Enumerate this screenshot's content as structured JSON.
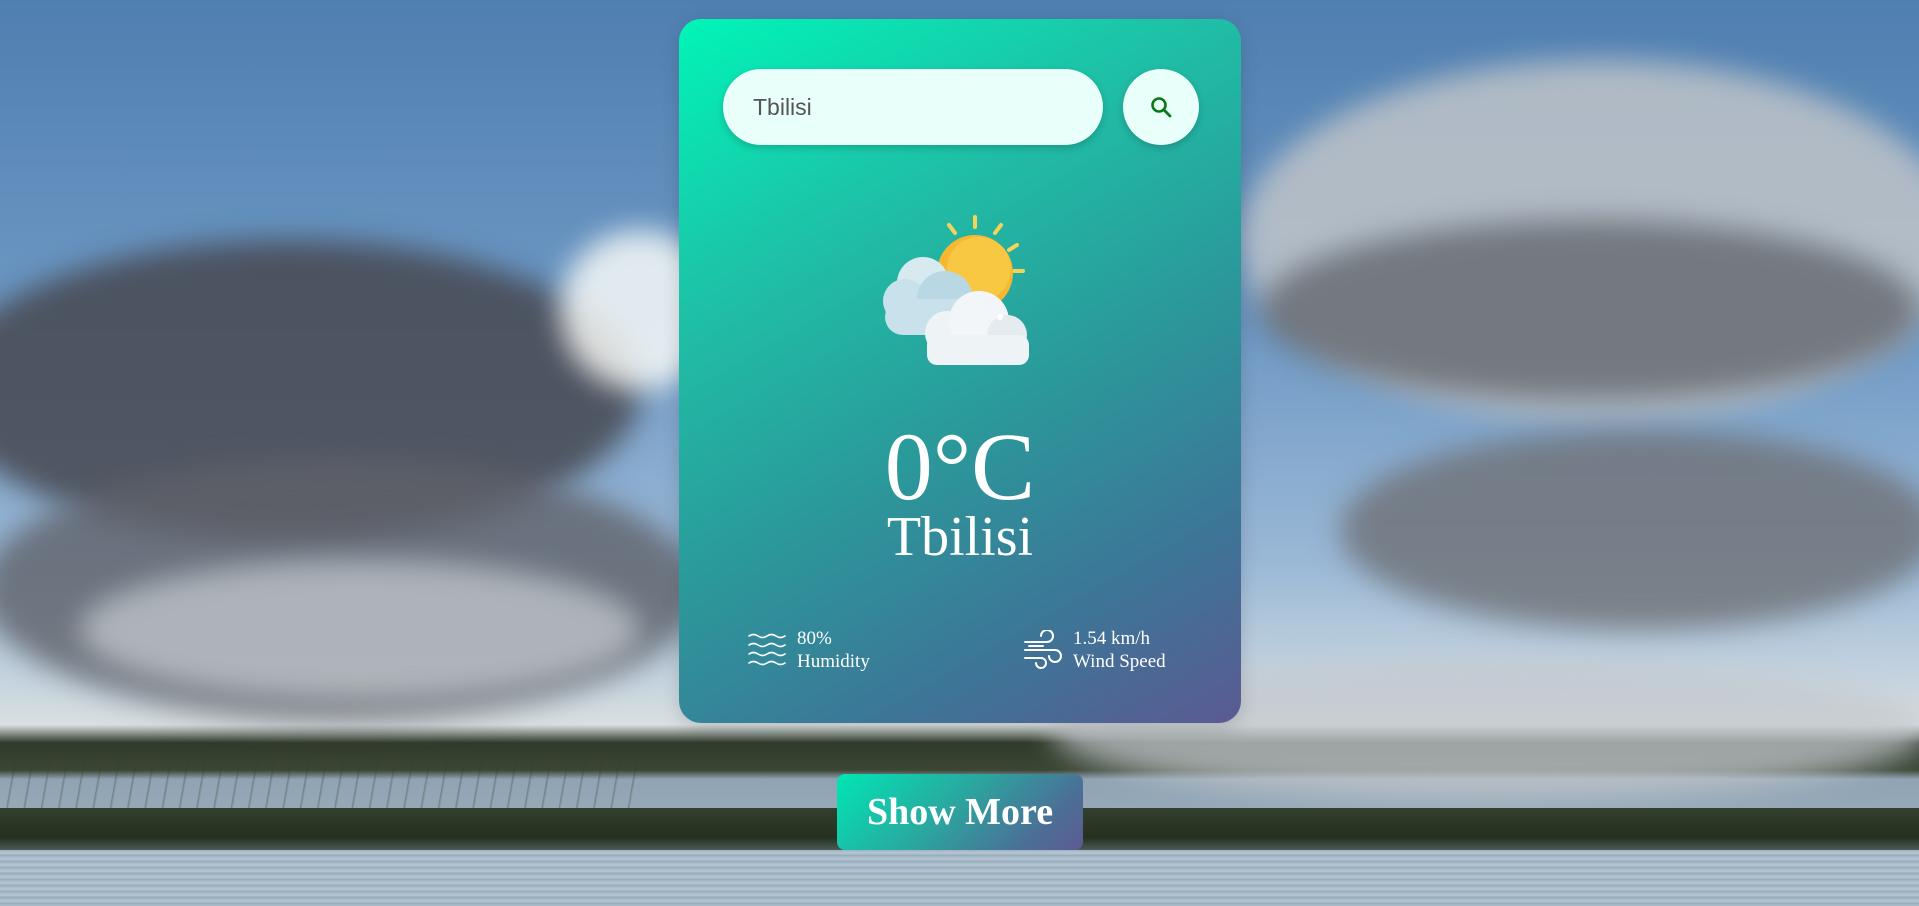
{
  "search": {
    "value": "Tbilisi",
    "placeholder": ""
  },
  "icons": {
    "search_button": "search-icon",
    "weather": "partly-cloudy-sun-icon",
    "humidity": "humidity-waves-icon",
    "wind": "wind-icon"
  },
  "weather": {
    "temperature": "0°C",
    "city": "Tbilisi",
    "humidity_value": "80%",
    "humidity_label": "Humidity",
    "wind_value": "1.54 km/h",
    "wind_label": "Wind Speed"
  },
  "actions": {
    "show_more_label": "Show More"
  },
  "colors": {
    "card_gradient_start": "#00f5b8",
    "card_gradient_end": "#5b5a92",
    "search_bg": "#e9fff9",
    "search_icon": "#0a7a16",
    "text": "#ffffff"
  }
}
